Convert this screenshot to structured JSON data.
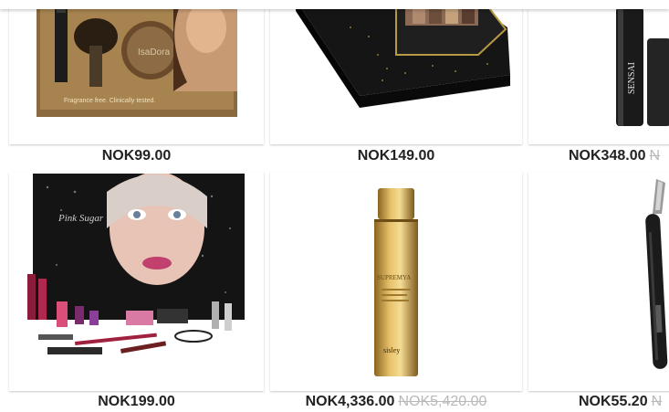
{
  "colors": {
    "price": "#222222",
    "old_price": "#b9b9b9",
    "card_bg": "#ffffff"
  },
  "products": [
    {
      "image": "isadora-bronzing-gift-set",
      "image_text": [
        "IsaDora",
        "Fragrance free. Clinically tested."
      ],
      "price": "NOK99.00",
      "old_price": ""
    },
    {
      "image": "black-gold-eyeshadow-palette-box",
      "image_text": [],
      "price": "NOK149.00",
      "old_price": ""
    },
    {
      "image": "sensai-black-tube",
      "image_text": [
        "SENSAI"
      ],
      "price": "NOK348.00",
      "old_price": "N"
    },
    {
      "image": "makeup-advent-calendar",
      "image_text": [
        "Pink Sugar"
      ],
      "price": "NOK199.00",
      "old_price": ""
    },
    {
      "image": "sisley-supremya-gold-bottle",
      "image_text": [
        "SUPREMYA",
        "sisley"
      ],
      "price": "NOK4,336.00",
      "old_price": "NOK5,420.00"
    },
    {
      "image": "black-eyebrow-razor",
      "image_text": [],
      "price": "NOK55.20",
      "old_price": "N"
    }
  ]
}
